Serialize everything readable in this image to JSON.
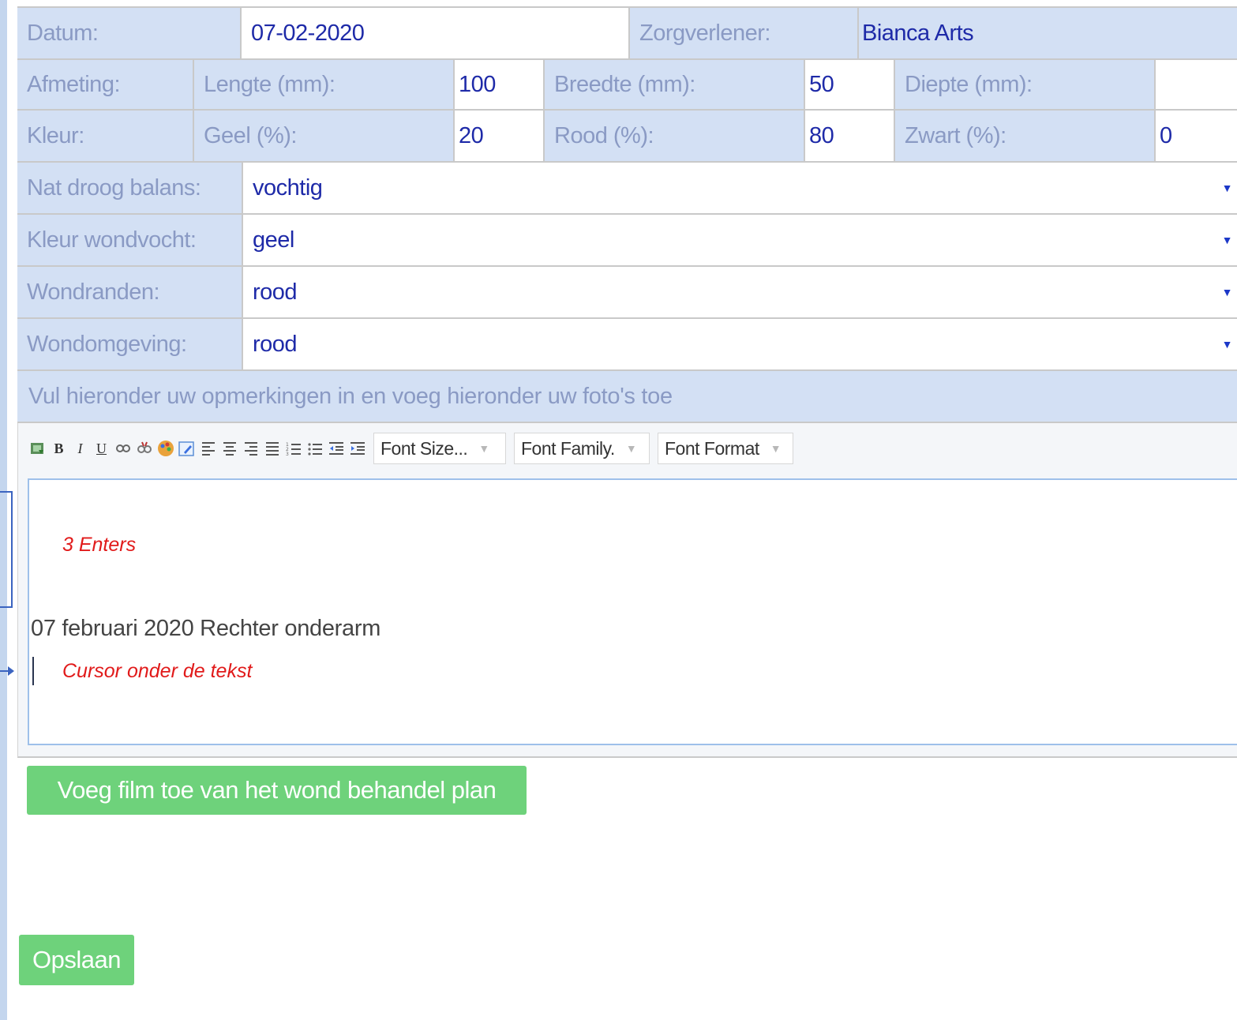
{
  "form": {
    "row1": {
      "datum_label": "Datum:",
      "datum_value": "07-02-2020",
      "zorgverlener_label": "Zorgverlener:",
      "zorgverlener_value": "Bianca Arts"
    },
    "row2": {
      "label": "Afmeting:",
      "lengte_label": "Lengte (mm):",
      "lengte_value": "100",
      "breedte_label": "Breedte (mm):",
      "breedte_value": "50",
      "diepte_label": "Diepte (mm):",
      "diepte_value": ""
    },
    "row3": {
      "label": "Kleur:",
      "geel_label": "Geel (%):",
      "geel_value": "20",
      "rood_label": "Rood (%):",
      "rood_value": "80",
      "zwart_label": "Zwart (%):",
      "zwart_value": "0"
    },
    "selects": [
      {
        "label": "Nat droog balans:",
        "value": "vochtig"
      },
      {
        "label": "Kleur wondvocht:",
        "value": "geel"
      },
      {
        "label": "Wondranden:",
        "value": "rood"
      },
      {
        "label": "Wondomgeving:",
        "value": "rood"
      }
    ],
    "notice": "Vul hieronder uw opmerkingen in en voeg hieronder uw foto's toe"
  },
  "toolbar": {
    "bold": "B",
    "italic": "I",
    "underline": "U",
    "font_size": "Font Size...",
    "font_family": "Font Family.",
    "font_format": "Font Format",
    "icons": [
      "insert-image-icon",
      "link-icon",
      "unlink-icon",
      "color-palette-icon",
      "edit-source-icon",
      "align-left-icon",
      "align-center-icon",
      "align-right-icon",
      "align-justify-icon",
      "ordered-list-icon",
      "unordered-list-icon",
      "outdent-icon",
      "indent-icon"
    ]
  },
  "editor": {
    "content": "07 februari 2020  Rechter onderarm"
  },
  "annotations": {
    "enters": "3 Enters",
    "cursor": "Cursor onder de tekst"
  },
  "buttons": {
    "add_film": "Voeg film toe van het wond behandel plan",
    "save": "Opslaan"
  },
  "colors": {
    "label_bg": "#d3e0f4",
    "value_text": "#1e2aa8",
    "label_text": "#8a9ac4",
    "button_green": "#6ed27b",
    "annotation_red": "#e11a1a"
  }
}
